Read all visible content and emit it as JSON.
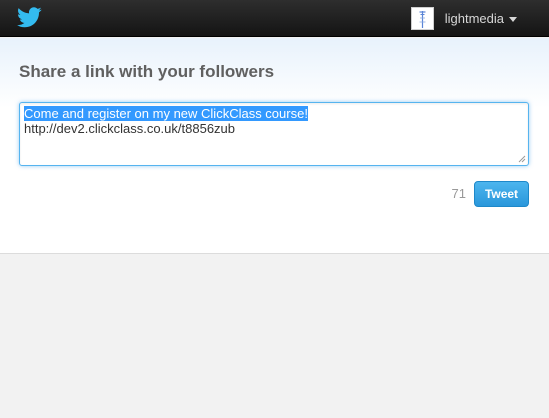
{
  "header": {
    "logo_icon": "twitter-bird-icon",
    "username": "lightmedia",
    "avatar_icon": "user-avatar-icon",
    "menu_icon": "caret-down-icon"
  },
  "share": {
    "heading": "Share a link with your followers",
    "selected_text": "Come and register on my new ClickClass course!",
    "link_text": "http://dev2.clickclass.co.uk/t8856zub",
    "char_count": "71",
    "tweet_label": "Tweet"
  },
  "colors": {
    "accent": "#2a97db",
    "topbar": "#1b1b1b",
    "selection": "#3399ff"
  }
}
